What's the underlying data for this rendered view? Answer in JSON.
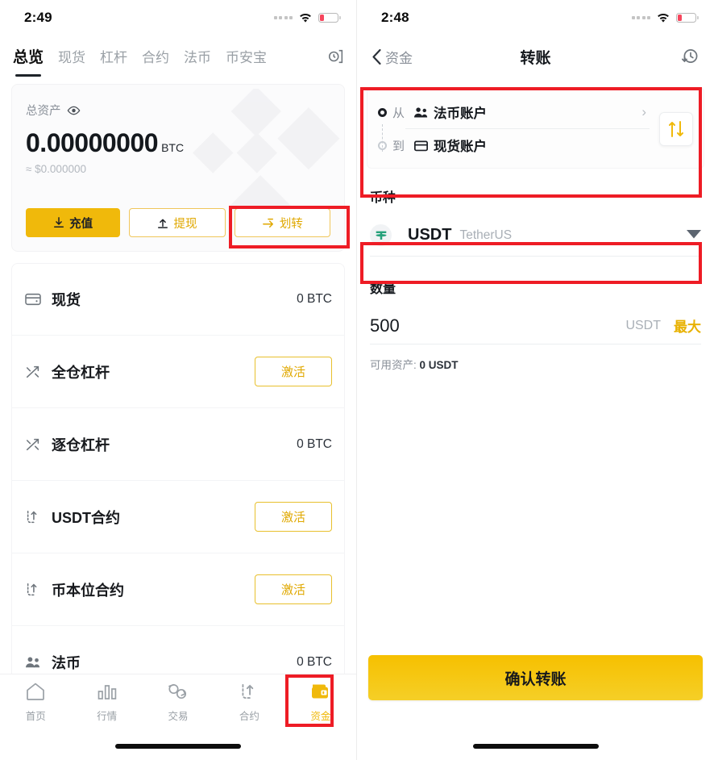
{
  "left": {
    "status": {
      "time": "2:49"
    },
    "tabs": [
      {
        "label": "总览",
        "active": true
      },
      {
        "label": "现货",
        "active": false
      },
      {
        "label": "杠杆",
        "active": false
      },
      {
        "label": "合约",
        "active": false
      },
      {
        "label": "法币",
        "active": false
      },
      {
        "label": "币安宝",
        "active": false
      }
    ],
    "tab_end_icon": "history-doc-icon",
    "balance": {
      "label": "总资产",
      "eye_icon": "eye-icon",
      "amount": "0.00000000",
      "unit": "BTC",
      "approx": "≈ $0.000000",
      "buttons": [
        {
          "label": "充值",
          "icon": "deposit-arrow-down-icon",
          "style": "solid"
        },
        {
          "label": "提现",
          "icon": "withdraw-arrow-up-icon",
          "style": "ghost"
        },
        {
          "label": "划转",
          "icon": "transfer-arrows-icon",
          "style": "ghost",
          "highlighted": true
        }
      ]
    },
    "accounts": [
      {
        "icon": "wallet-card-icon",
        "name": "现货",
        "value": "0 BTC"
      },
      {
        "icon": "margin-cross-icon",
        "name": "全仓杠杆",
        "action": "激活"
      },
      {
        "icon": "margin-cross-icon",
        "name": "逐仓杠杆",
        "value": "0 BTC"
      },
      {
        "icon": "futures-arrow-icon",
        "name": "USDT合约",
        "action": "激活"
      },
      {
        "icon": "futures-arrow-icon",
        "name": "币本位合约",
        "action": "激活"
      },
      {
        "icon": "people-icon",
        "name": "法币",
        "value": "0 BTC"
      }
    ],
    "bottom_nav": [
      {
        "icon": "home-icon",
        "label": "首页",
        "active": false
      },
      {
        "icon": "markets-bars-icon",
        "label": "行情",
        "active": false
      },
      {
        "icon": "trade-swap-icon",
        "label": "交易",
        "active": false
      },
      {
        "icon": "futures-arrow-icon",
        "label": "合约",
        "active": false
      },
      {
        "icon": "wallet-icon",
        "label": "资金",
        "active": true
      }
    ]
  },
  "right": {
    "status": {
      "time": "2:48"
    },
    "navbar": {
      "back_label": "资金",
      "back_icon": "chevron-left-icon",
      "title": "转账",
      "history_icon": "history-clock-icon"
    },
    "transfer": {
      "from_tag": "从",
      "from_account": "法币账户",
      "from_icon": "people-icon",
      "to_tag": "到",
      "to_account": "现货账户",
      "to_icon": "wallet-card-icon",
      "chevron": "chevron-right-icon",
      "swap_icon": "swap-vertical-icon"
    },
    "coin": {
      "label": "币种",
      "symbol": "USDT",
      "full_name": "TetherUS",
      "logo": "tether-icon",
      "caret": "caret-down-icon"
    },
    "amount": {
      "label": "数量",
      "value": "500",
      "unit": "USDT",
      "max_label": "最大",
      "available_label": "可用资产:",
      "available_value": "0 USDT"
    },
    "confirm_label": "确认转账"
  },
  "colors": {
    "brand_yellow": "#f0b90b",
    "highlight_red": "#ee1c25",
    "text_dark": "#14181d",
    "text_muted": "#8a9099",
    "tether_green": "#26a17b",
    "battery_red": "#f6465d"
  }
}
